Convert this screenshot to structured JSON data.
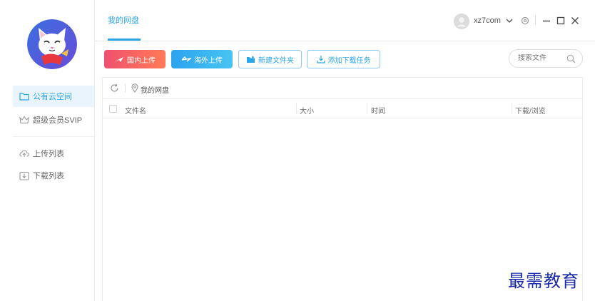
{
  "sidebar": {
    "items": [
      {
        "label": "公有云空间",
        "active": true
      },
      {
        "label": "超级会员SVIP",
        "active": false
      },
      {
        "label": "上传列表",
        "active": false
      },
      {
        "label": "下载列表",
        "active": false
      }
    ]
  },
  "header": {
    "tab_label": "我的网盘",
    "username": "xz7com"
  },
  "toolbar": {
    "domestic_upload": "国内上传",
    "overseas_upload": "海外上传",
    "new_folder": "新建文件夹",
    "add_download": "添加下载任务"
  },
  "search": {
    "placeholder": "搜索文件",
    "value": ""
  },
  "breadcrumb": {
    "path": "我的网盘"
  },
  "table": {
    "columns": [
      "文件名",
      "大小",
      "时间",
      "下载/浏览"
    ],
    "rows": []
  },
  "watermark": "最需教育",
  "colors": {
    "accent": "#2aa5e8",
    "domestic_gradient_start": "#f0506e",
    "domestic_gradient_end": "#ff7a56",
    "overseas_gradient_start": "#2ba3ef",
    "overseas_gradient_end": "#47c4f2",
    "watermark": "#1a2aa8"
  }
}
